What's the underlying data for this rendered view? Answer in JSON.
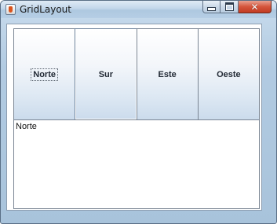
{
  "window": {
    "title": "GridLayout",
    "icon": "java-app-icon",
    "controls": {
      "minimize": "minimize-icon",
      "maximize": "maximize-icon",
      "close": "close-icon"
    }
  },
  "buttons": [
    {
      "label": "Norte",
      "focused": true
    },
    {
      "label": "Sur",
      "focused": false
    },
    {
      "label": "Este",
      "focused": false
    },
    {
      "label": "Oeste",
      "focused": false
    }
  ],
  "text_area": {
    "value": "Norte"
  }
}
